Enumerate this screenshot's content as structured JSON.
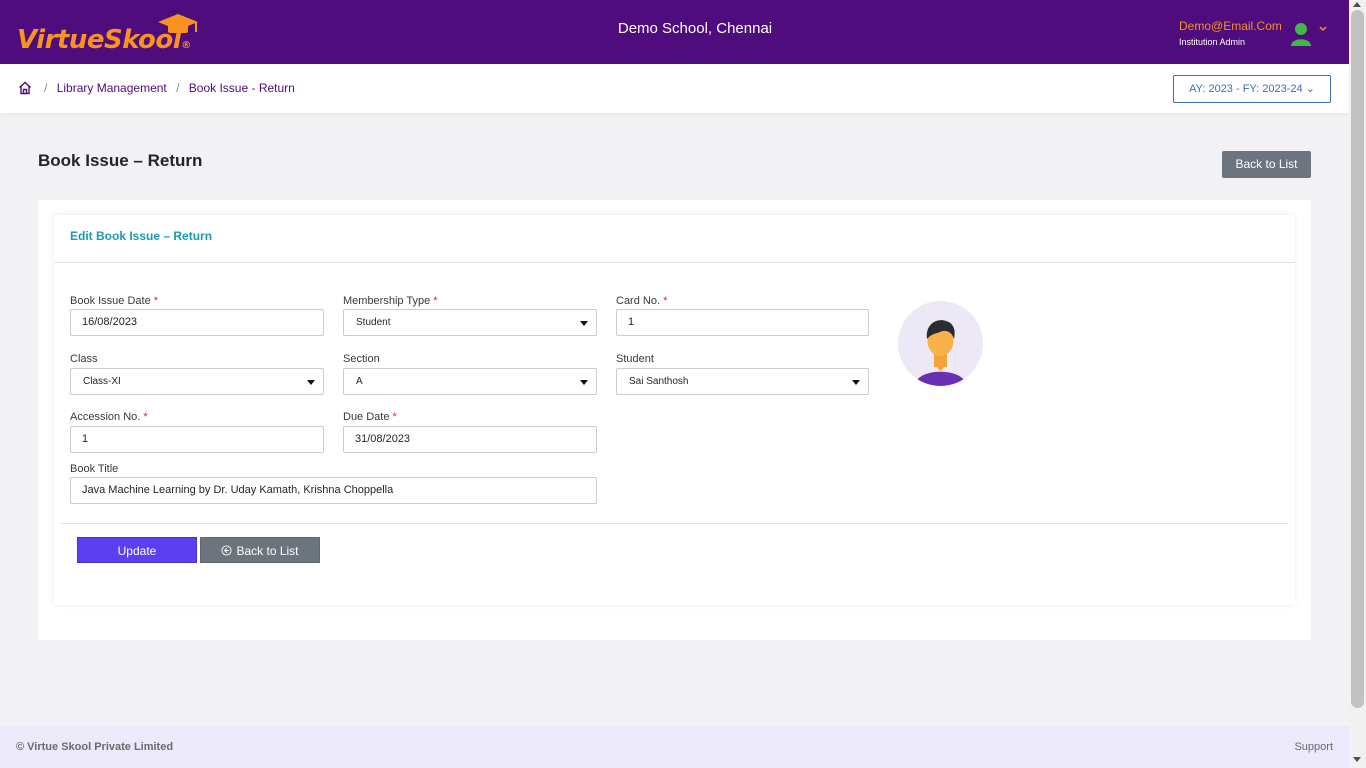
{
  "header": {
    "logo_text": "VirtueSkool",
    "logo_reg": "®",
    "school_name": "Demo School, Chennai",
    "user_email": "Demo@Email.Com",
    "user_role": "Institution Admin",
    "accent_color": "#f7931e",
    "bar_color": "#4e0c7d"
  },
  "breadcrumb": {
    "items": [
      "Library Management",
      "Book Issue - Return"
    ],
    "separator": "/"
  },
  "year_selector": "AY: 2023 - FY: 2023-24 ⌄",
  "page_title": "Book Issue – Return",
  "back_to_list_top": "Back to List",
  "card": {
    "title": "Edit Book Issue – Return"
  },
  "form": {
    "book_issue_date": {
      "label": "Book Issue Date",
      "value": "16/08/2023",
      "required": "*"
    },
    "membership_type": {
      "label": "Membership Type",
      "value": "Student",
      "required": "*"
    },
    "card_no": {
      "label": "Card No.",
      "value": "1",
      "required": "*"
    },
    "class": {
      "label": "Class",
      "value": "Class-XI"
    },
    "section": {
      "label": "Section",
      "value": "A"
    },
    "student": {
      "label": "Student",
      "value": "Sai Santhosh"
    },
    "accession_no": {
      "label": "Accession No.",
      "value": "1",
      "required": "*"
    },
    "due_date": {
      "label": "Due Date",
      "value": "31/08/2023",
      "required": "*"
    },
    "book_title": {
      "label": "Book Title",
      "value": "Java Machine Learning by Dr. Uday Kamath, Krishna Choppella"
    }
  },
  "buttons": {
    "update": "Update",
    "back_to_list": "Back to List"
  },
  "footer": {
    "copyright": "© Virtue Skool Private Limited",
    "support": "Support"
  },
  "icons": [
    "graduation-cap-icon",
    "user-icon",
    "chevron-down-icon",
    "home-icon",
    "dropdown-caret-icon",
    "back-circle-icon",
    "student-avatar"
  ]
}
